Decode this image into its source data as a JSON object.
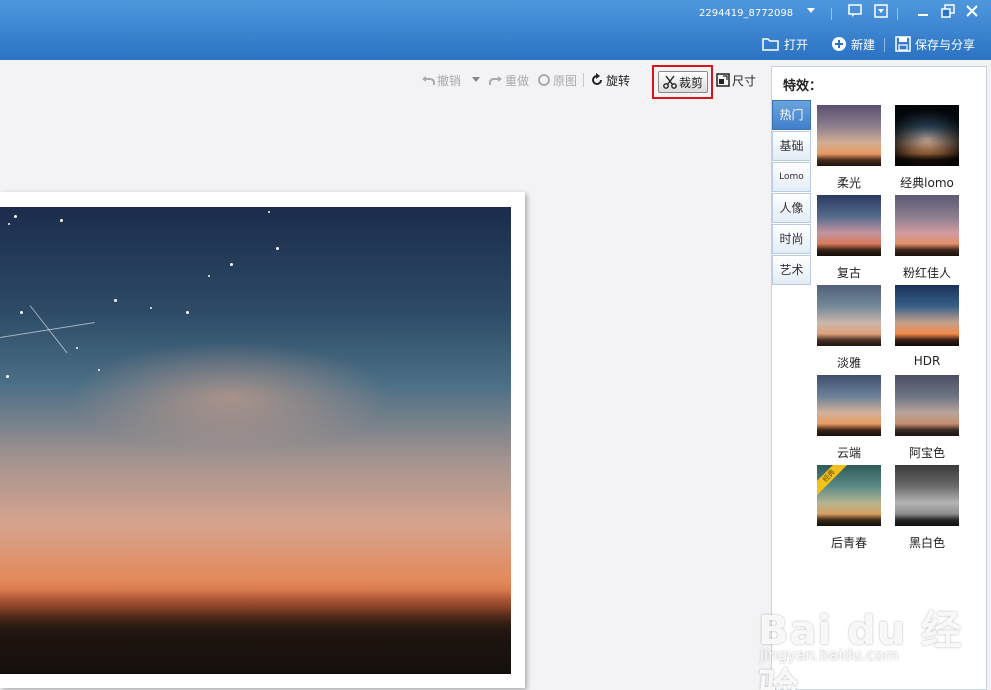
{
  "titlebar": {
    "account": "2294419_8772098",
    "buttons": {
      "open": "打开",
      "new": "新建",
      "save_share": "保存与分享"
    }
  },
  "toolbar": {
    "undo": "撤销",
    "redo": "重做",
    "original": "原图",
    "rotate": "旋转",
    "crop": "裁剪",
    "size": "尺寸"
  },
  "highlight_color": "#d8141b",
  "effects_panel": {
    "title": "特效：",
    "tabs": [
      "热门",
      "基础",
      "Lomo",
      "人像",
      "时尚",
      "艺术"
    ],
    "active_tab": "热门",
    "effects": [
      "柔光",
      "经典lomo",
      "复古",
      "粉红佳人",
      "淡雅",
      "HDR",
      "云端",
      "阿宝色",
      "后青春",
      "黑白色"
    ],
    "badge": "经典"
  },
  "watermark": {
    "logo": "Bai du 经验",
    "url": "jingyan.baidu.com"
  }
}
